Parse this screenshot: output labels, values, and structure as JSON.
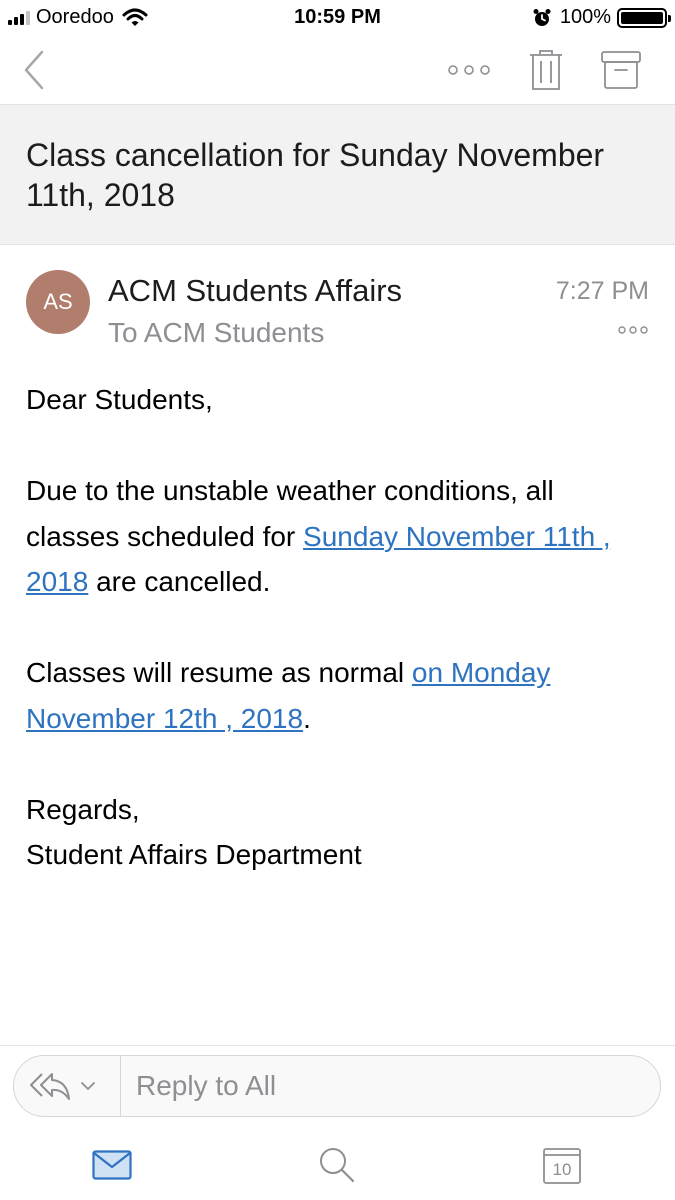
{
  "status_bar": {
    "carrier": "Ooredoo",
    "time": "10:59 PM",
    "battery": "100%"
  },
  "toolbar": {
    "back_icon": "chevron-left-icon",
    "more_icon": "more-horizontal-icon",
    "delete_icon": "trash-icon",
    "archive_icon": "archive-icon"
  },
  "message": {
    "subject": "Class cancellation for Sunday November 11th, 2018",
    "avatar_initials": "AS",
    "avatar_color": "#b17d6c",
    "sender": "ACM Students Affairs",
    "recipients": "To ACM Students",
    "time": "7:27 PM",
    "body": {
      "greeting": "Dear Students,",
      "p1_before": "Due to the unstable weather conditions, all classes scheduled for ",
      "p1_link": "Sunday November 11th , 2018",
      "p1_after": " are cancelled.",
      "p2_before": "Classes will resume as normal ",
      "p2_link": "on Monday November 12th , 2018",
      "p2_after": ".",
      "closing": "Regards,",
      "signature": "Student Affairs Department"
    }
  },
  "reply_bar": {
    "placeholder": "Reply to All"
  },
  "tab_bar": {
    "calendar_day": "10",
    "active_tab": "mail"
  },
  "colors": {
    "link": "#2e73c0",
    "accent": "#2e73c0",
    "secondary_text": "#8e8e93",
    "subject_background": "#f2f2f2"
  }
}
